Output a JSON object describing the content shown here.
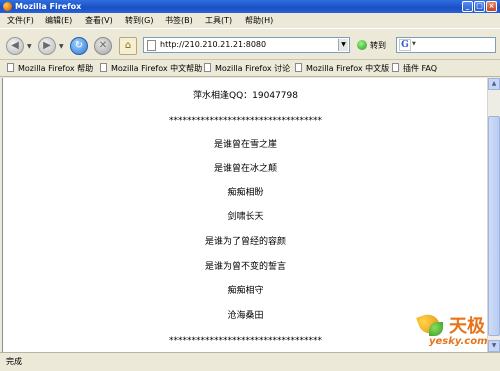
{
  "window": {
    "title": "Mozilla Firefox"
  },
  "menu": [
    {
      "label": "文件(F)"
    },
    {
      "label": "编辑(E)"
    },
    {
      "label": "查看(V)"
    },
    {
      "label": "转到(G)"
    },
    {
      "label": "书签(B)"
    },
    {
      "label": "工具(T)"
    },
    {
      "label": "帮助(H)"
    }
  ],
  "navigation": {
    "url": "http://210.210.21.21:8080",
    "go_label": "转到",
    "search_engine_icon": "G"
  },
  "bookmarks": [
    {
      "label": "Mozilla Firefox 帮助"
    },
    {
      "label": "Mozilla Firefox 中文帮助"
    },
    {
      "label": "Mozilla Firefox 讨论"
    },
    {
      "label": "Mozilla Firefox 中文版"
    },
    {
      "label": "插件 FAQ"
    }
  ],
  "page": {
    "lines": [
      "萍水相逢QQ：19047798",
      "**********************************",
      "是谁曾在雪之崖",
      "是谁曾在冰之颠",
      "痴痴相盼",
      "剑啸长天",
      "是谁为了曾经的容颜",
      "是谁为曾不变的誓言",
      "痴痴相守",
      "沧海桑田",
      "**********************************"
    ]
  },
  "watermark": {
    "logo": "天极",
    "site": "yesky.com"
  },
  "status": {
    "text": "完成"
  },
  "colors": {
    "titlebar": "#1a4fc4",
    "chrome": "#ece9d8",
    "watermark": "#e8731a"
  }
}
